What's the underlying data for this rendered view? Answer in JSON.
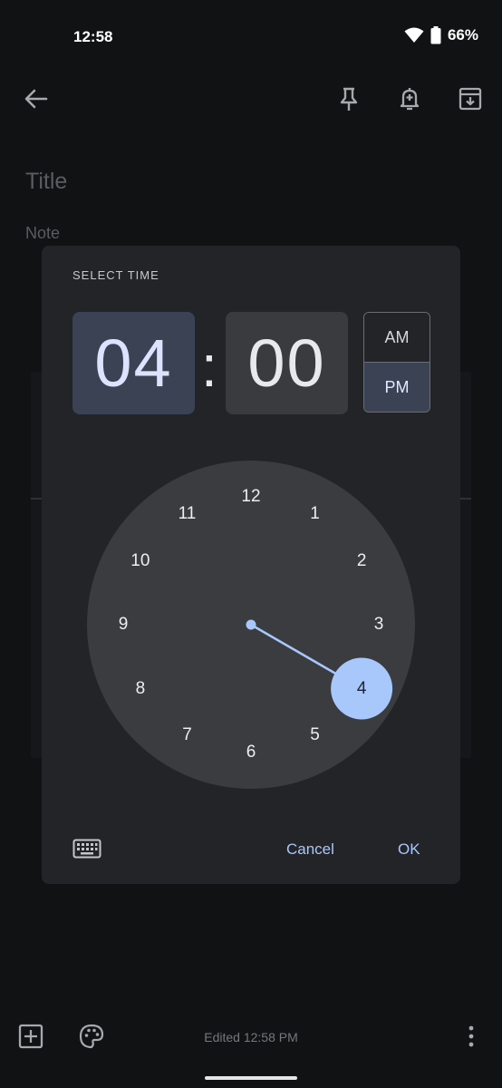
{
  "status_bar": {
    "time": "12:58",
    "battery": "66%"
  },
  "note": {
    "title_placeholder": "Title",
    "body_placeholder": "Note",
    "edited": "Edited 12:58 PM"
  },
  "time_picker": {
    "label": "SELECT TIME",
    "hour": "04",
    "separator": ":",
    "minute": "00",
    "am_label": "AM",
    "pm_label": "PM",
    "period_selected": "PM",
    "dial_numbers": [
      "12",
      "1",
      "2",
      "3",
      "4",
      "5",
      "6",
      "7",
      "8",
      "9",
      "10",
      "11"
    ],
    "selected_hour": 4,
    "cancel_label": "Cancel",
    "ok_label": "OK"
  },
  "icons": {
    "back": "arrow-left",
    "pin": "pin",
    "reminder": "bell-plus",
    "archive": "archive",
    "add": "plus-square",
    "palette": "palette",
    "more": "vertical-dots",
    "keyboard": "keyboard"
  },
  "colors": {
    "accent": "#a8c7fa",
    "selected_bg": "#3a4253",
    "dialog_bg": "#222428",
    "dial_bg": "#3a3c40"
  }
}
